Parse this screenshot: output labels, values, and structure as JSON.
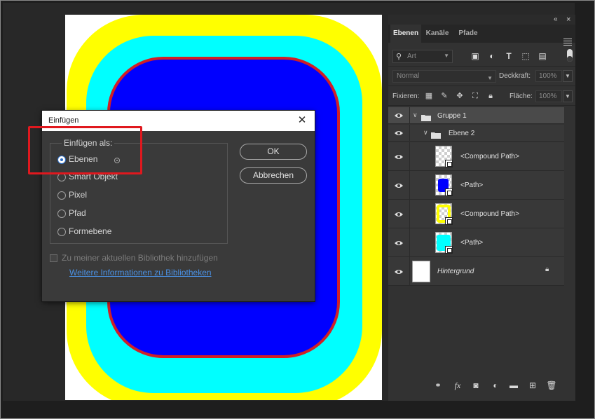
{
  "colors": {
    "outer": "#ffff00",
    "middle": "#00ffff",
    "inner": "#0000ff",
    "highlight": "#e0181e"
  },
  "panel": {
    "tabs": [
      {
        "label": "Ebenen"
      },
      {
        "label": "Kanäle"
      },
      {
        "label": "Pfade"
      }
    ],
    "filter": {
      "placeholder": "Art"
    },
    "blend_mode": "Normal",
    "opacity": {
      "label": "Deckkraft:",
      "value": "100%"
    },
    "lock": {
      "label": "Fixieren:"
    },
    "fill": {
      "label": "Fläche:",
      "value": "100%"
    },
    "layers": [
      {
        "name": "Gruppe 1",
        "kind": "group"
      },
      {
        "name": "Ebene 2",
        "kind": "group"
      },
      {
        "name": "<Compound Path>",
        "kind": "path"
      },
      {
        "name": "<Path>",
        "kind": "path"
      },
      {
        "name": "<Compound Path>",
        "kind": "path"
      },
      {
        "name": "<Path>",
        "kind": "path"
      },
      {
        "name": "Hintergrund",
        "kind": "background"
      }
    ]
  },
  "dialog": {
    "title": "Einfügen",
    "legend": "Einfügen als:",
    "options": [
      {
        "label": "Ebenen",
        "selected": true
      },
      {
        "label": "Smart Objekt",
        "selected": false
      },
      {
        "label": "Pixel",
        "selected": false
      },
      {
        "label": "Pfad",
        "selected": false
      },
      {
        "label": "Formebene",
        "selected": false
      }
    ],
    "ok_label": "OK",
    "cancel_label": "Abbrechen",
    "library_checkbox": "Zu meiner aktuellen Bibliothek hinzufügen",
    "library_link": "Weitere Informationen zu Bibliotheken"
  }
}
